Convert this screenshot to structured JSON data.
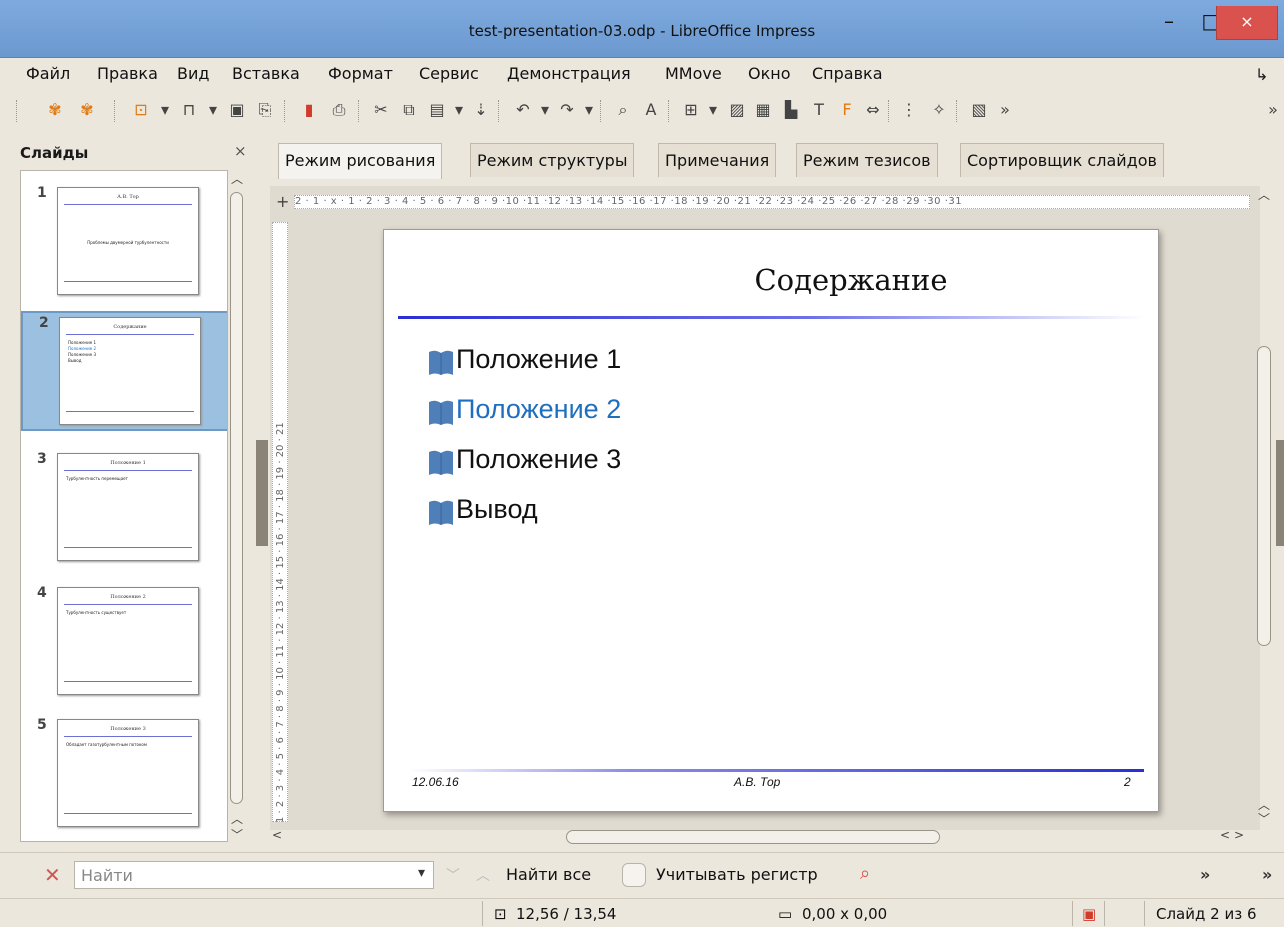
{
  "window": {
    "title": "test-presentation-03.odp - LibreOffice Impress",
    "minimize_glyph": "–",
    "maximize_glyph": "□",
    "close_glyph": "×"
  },
  "menu": [
    "Файл",
    "Правка",
    "Вид",
    "Вставка",
    "Формат",
    "Сервис",
    "Демонстрация",
    "MMove",
    "Окно",
    "Справка"
  ],
  "toolbar": {
    "overflow": "»"
  },
  "slides_panel": {
    "title": "Слайды",
    "close": "×",
    "thumbnails": [
      {
        "number": "1",
        "title": "А.В. Тор",
        "body": "Проблемы двумерной турбулентности"
      },
      {
        "number": "2",
        "title": "Содержание",
        "items": [
          "Положение 1",
          "Положение 2",
          "Положение 3",
          "Вывод"
        ]
      },
      {
        "number": "3",
        "title": "Положение 1",
        "body": "Турбулентность перемещает"
      },
      {
        "number": "4",
        "title": "Положение 2",
        "body": "Турбулентность существует"
      },
      {
        "number": "5",
        "title": "Положение 3",
        "body": "Обладает газотурбулентным потоком"
      }
    ]
  },
  "tabs": [
    "Режим рисования",
    "Режим структуры",
    "Примечания",
    "Режим тезисов",
    "Сортировщик слайдов"
  ],
  "ruler": {
    "horizontal": "2 · 1 · ⅹ · 1 · 2 · 3 · 4 · 5 · 6 · 7 · 8 · 9 ·10 ·11 ·12 ·13 ·14 ·15 ·16 ·17 ·18 ·19 ·20 ·21 ·22 ·23 ·24 ·25 ·26 ·27 ·28 ·29 ·30 ·31",
    "vertical": "1 · 2 · 3 · 4 · 5 · 6 · 7 · 8 · 9 · 10 · 11 · 12 · 13 · 14 · 15 · 16 · 17 · 18 · 19 · 20 · 21"
  },
  "slide": {
    "title": "Содержание",
    "bullets": [
      {
        "text": "Положение 1",
        "highlighted": false
      },
      {
        "text": "Положение 2",
        "highlighted": true
      },
      {
        "text": "Положение 3",
        "highlighted": false
      },
      {
        "text": "Вывод",
        "highlighted": false
      }
    ],
    "footer_date": "12.06.16",
    "footer_author": "А.В. Тор",
    "footer_page": "2"
  },
  "findbar": {
    "placeholder": "Найти",
    "find_all": "Найти все",
    "match_case": "Учитывать регистр"
  },
  "status": {
    "position": "12,56 / 13,54",
    "size": "0,00 x 0,00",
    "slide_info": "Слайд 2 из 6"
  },
  "colors": {
    "titlebar": "#6f9ed3",
    "close_button": "#d9524e",
    "accent_blue": "#1f6fbf",
    "rule_blue": "#2a2fd4"
  }
}
